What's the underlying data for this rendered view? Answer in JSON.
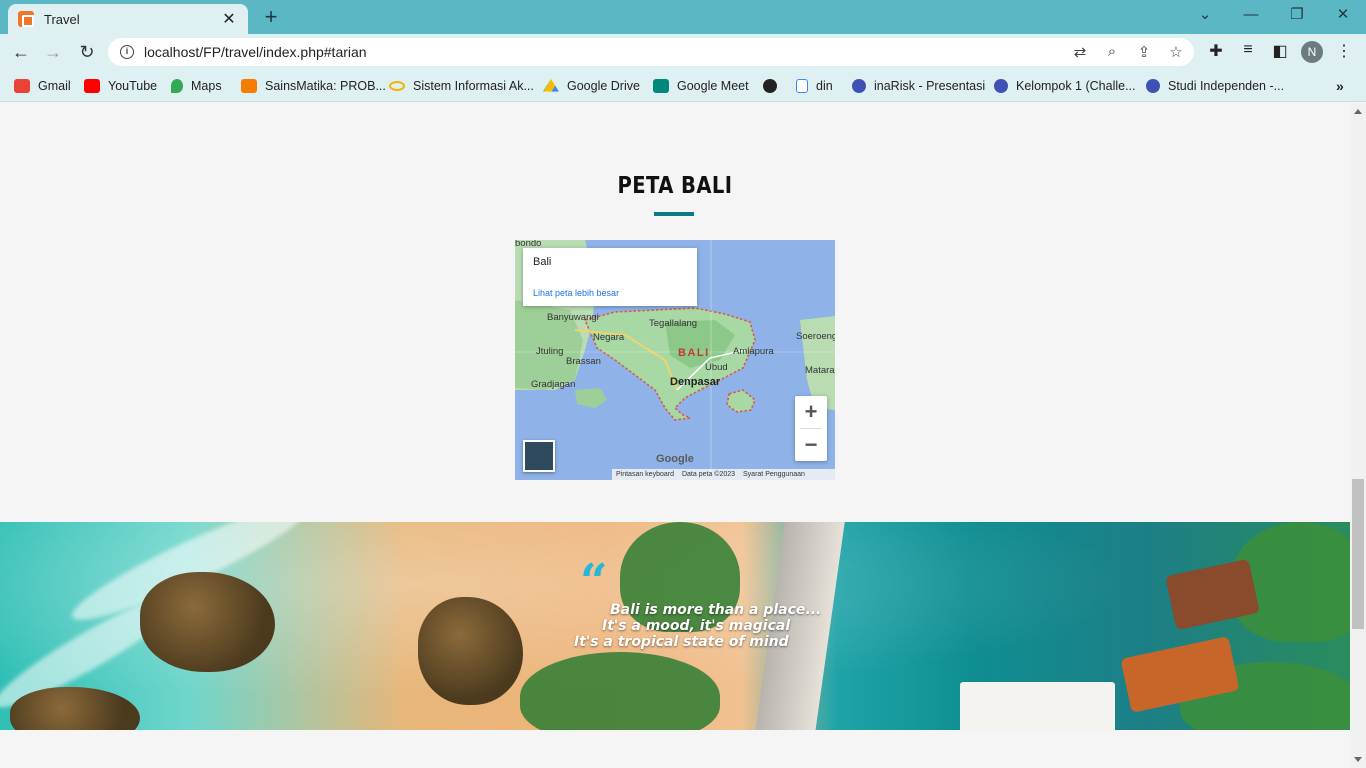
{
  "browser": {
    "tab_title": "Travel",
    "url": "localhost/FP/travel/index.php#tarian",
    "profile_initial": "N"
  },
  "bookmarks": [
    {
      "label": "Gmail",
      "icon": "gmail-icon",
      "color": "#ea4335"
    },
    {
      "label": "YouTube",
      "icon": "youtube-icon",
      "color": "#ff0000"
    },
    {
      "label": "Maps",
      "icon": "maps-icon",
      "color": "#34a853"
    },
    {
      "label": "SainsMatika: PROB...",
      "icon": "blogger-icon",
      "color": "#f57c00"
    },
    {
      "label": "Sistem Informasi Ak...",
      "icon": "infinity-icon",
      "color": "#f0b400"
    },
    {
      "label": "Google Drive",
      "icon": "drive-icon",
      "color": "#1e88e5"
    },
    {
      "label": "Google Meet",
      "icon": "meet-icon",
      "color": "#00897b"
    },
    {
      "label": "",
      "icon": "globe-icon",
      "color": "#222222"
    },
    {
      "label": "din",
      "icon": "document-icon",
      "color": "#4285f4"
    },
    {
      "label": "inaRisk - Presentasi",
      "icon": "c-logo-icon",
      "color": "#3f51b5"
    },
    {
      "label": "Kelompok 1 (Challe...",
      "icon": "c-logo-icon",
      "color": "#3f51b5"
    },
    {
      "label": "Studi Independen -...",
      "icon": "c-logo-icon",
      "color": "#3f51b5"
    }
  ],
  "section": {
    "title": "PETA BALI",
    "accent_color": "#0c7c84"
  },
  "map": {
    "card_title": "Bali",
    "card_link": "Lihat peta lebih besar",
    "labels": {
      "bondowoso": "bondo",
      "banyuwangi": "Banyuwangi",
      "tegallalang": "Tegallalang",
      "negara": "Negara",
      "bali": "BALI",
      "amlapura": "Amlapura",
      "seroeng": "Soeroeng",
      "jtuling": "Jtuling",
      "brassan": "Brassan",
      "ubud": "Ubud",
      "mataram": "Matara",
      "gradjagan": "Gradjagan",
      "denpasar": "Denpasar"
    },
    "google": "Google",
    "footer": [
      "Pintasan keyboard",
      "Data peta ©2023",
      "Syarat Penggunaan"
    ],
    "zoom_in": "+",
    "zoom_out": "−"
  },
  "quote": {
    "mark": "“",
    "lines": [
      "Bali is more than a place...",
      "It's a mood, it's magical",
      "It's a tropical state of mind"
    ]
  }
}
